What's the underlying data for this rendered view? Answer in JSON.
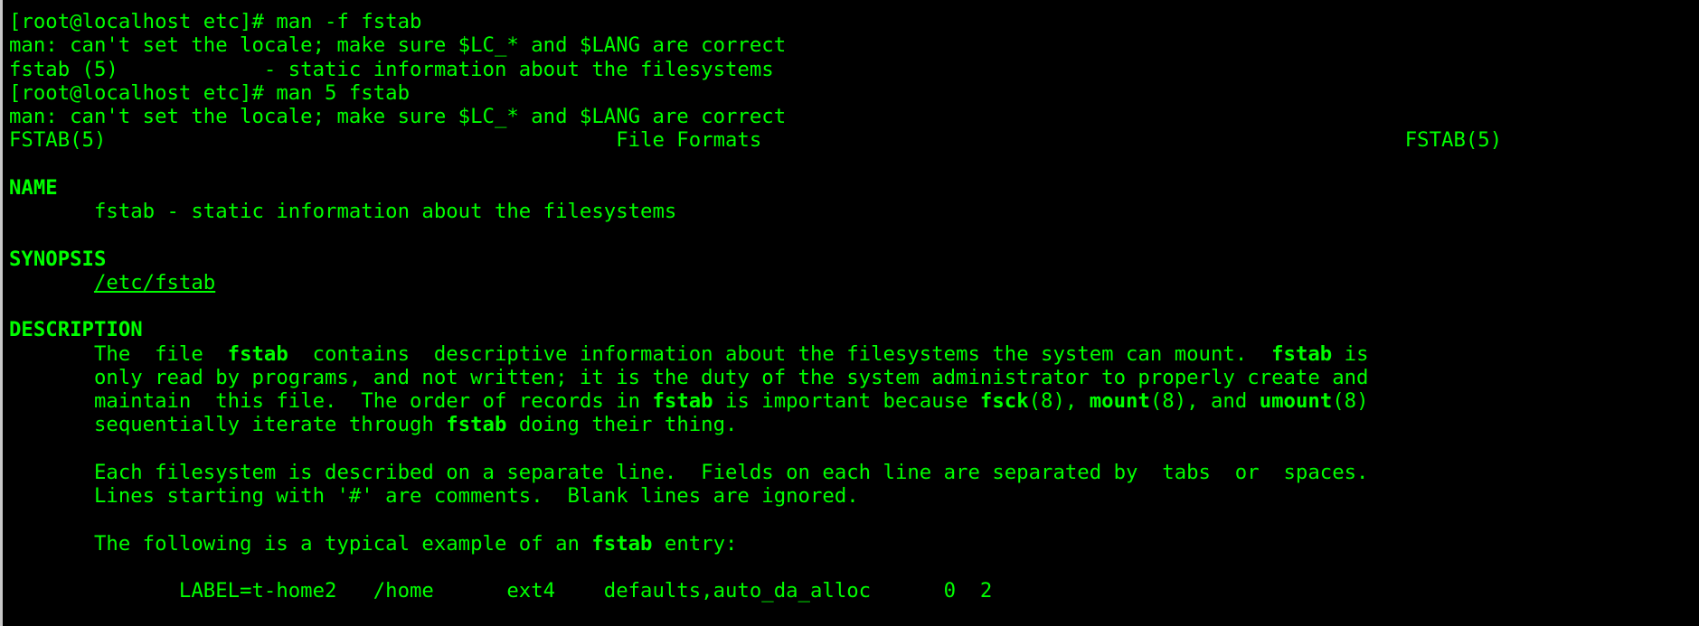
{
  "terminal": {
    "foreground": "#00ff00",
    "background": "#000000",
    "lines": [
      [
        {
          "t": "[root@localhost etc]# man -f fstab"
        }
      ],
      [
        {
          "t": "man: can't set the locale; make sure $LC_* and $LANG are correct"
        }
      ],
      [
        {
          "t": "fstab (5)            - static information about the filesystems"
        }
      ],
      [
        {
          "t": "[root@localhost etc]# man 5 fstab"
        }
      ],
      [
        {
          "t": "man: can't set the locale; make sure $LC_* and $LANG are correct"
        }
      ],
      [
        {
          "t": "FSTAB(5)                                          File Formats                                                     FSTAB(5)"
        }
      ],
      [
        {
          "t": ""
        }
      ],
      [
        {
          "t": "NAME",
          "b": true
        }
      ],
      [
        {
          "t": "       fstab - static information about the filesystems"
        }
      ],
      [
        {
          "t": ""
        }
      ],
      [
        {
          "t": "SYNOPSIS",
          "b": true
        }
      ],
      [
        {
          "t": "       "
        },
        {
          "t": "/etc/fstab",
          "u": true
        }
      ],
      [
        {
          "t": ""
        }
      ],
      [
        {
          "t": "DESCRIPTION",
          "b": true
        }
      ],
      [
        {
          "t": "       The  file  "
        },
        {
          "t": "fstab",
          "b": true
        },
        {
          "t": "  contains  descriptive information about the filesystems the system can mount.  "
        },
        {
          "t": "fstab",
          "b": true
        },
        {
          "t": " is"
        }
      ],
      [
        {
          "t": "       only read by programs, and not written; it is the duty of the system administrator to properly create and"
        }
      ],
      [
        {
          "t": "       maintain  this file.  The order of records in "
        },
        {
          "t": "fstab",
          "b": true
        },
        {
          "t": " is important because "
        },
        {
          "t": "fsck",
          "b": true
        },
        {
          "t": "(8), "
        },
        {
          "t": "mount",
          "b": true
        },
        {
          "t": "(8), and "
        },
        {
          "t": "umount",
          "b": true
        },
        {
          "t": "(8)"
        }
      ],
      [
        {
          "t": "       sequentially iterate through "
        },
        {
          "t": "fstab",
          "b": true
        },
        {
          "t": " doing their thing."
        }
      ],
      [
        {
          "t": ""
        }
      ],
      [
        {
          "t": "       Each filesystem is described on a separate line.  Fields on each line are separated by  tabs  or  spaces."
        }
      ],
      [
        {
          "t": "       Lines starting with '#' are comments.  Blank lines are ignored."
        }
      ],
      [
        {
          "t": ""
        }
      ],
      [
        {
          "t": "       The following is a typical example of an "
        },
        {
          "t": "fstab",
          "b": true
        },
        {
          "t": " entry:"
        }
      ],
      [
        {
          "t": ""
        }
      ],
      [
        {
          "t": "              LABEL=t-home2   /home      ext4    defaults,auto_da_alloc      0  2"
        }
      ]
    ]
  }
}
